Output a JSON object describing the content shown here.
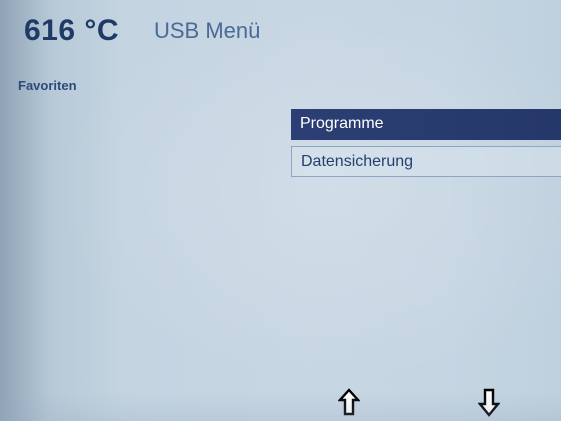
{
  "header": {
    "temperature": "616 °C",
    "title": "USB Menü"
  },
  "section": {
    "label": "Favoriten"
  },
  "menu": {
    "items": [
      {
        "label": "Programme",
        "selected": true
      },
      {
        "label": "Datensicherung",
        "selected": false
      }
    ]
  },
  "navigation": {
    "up_icon": "arrow-up-icon",
    "down_icon": "arrow-down-icon"
  },
  "colors": {
    "selection_background": "#2c3f74",
    "text_dark_blue": "#1f3a66",
    "screen_background": "#c7d6e3"
  }
}
